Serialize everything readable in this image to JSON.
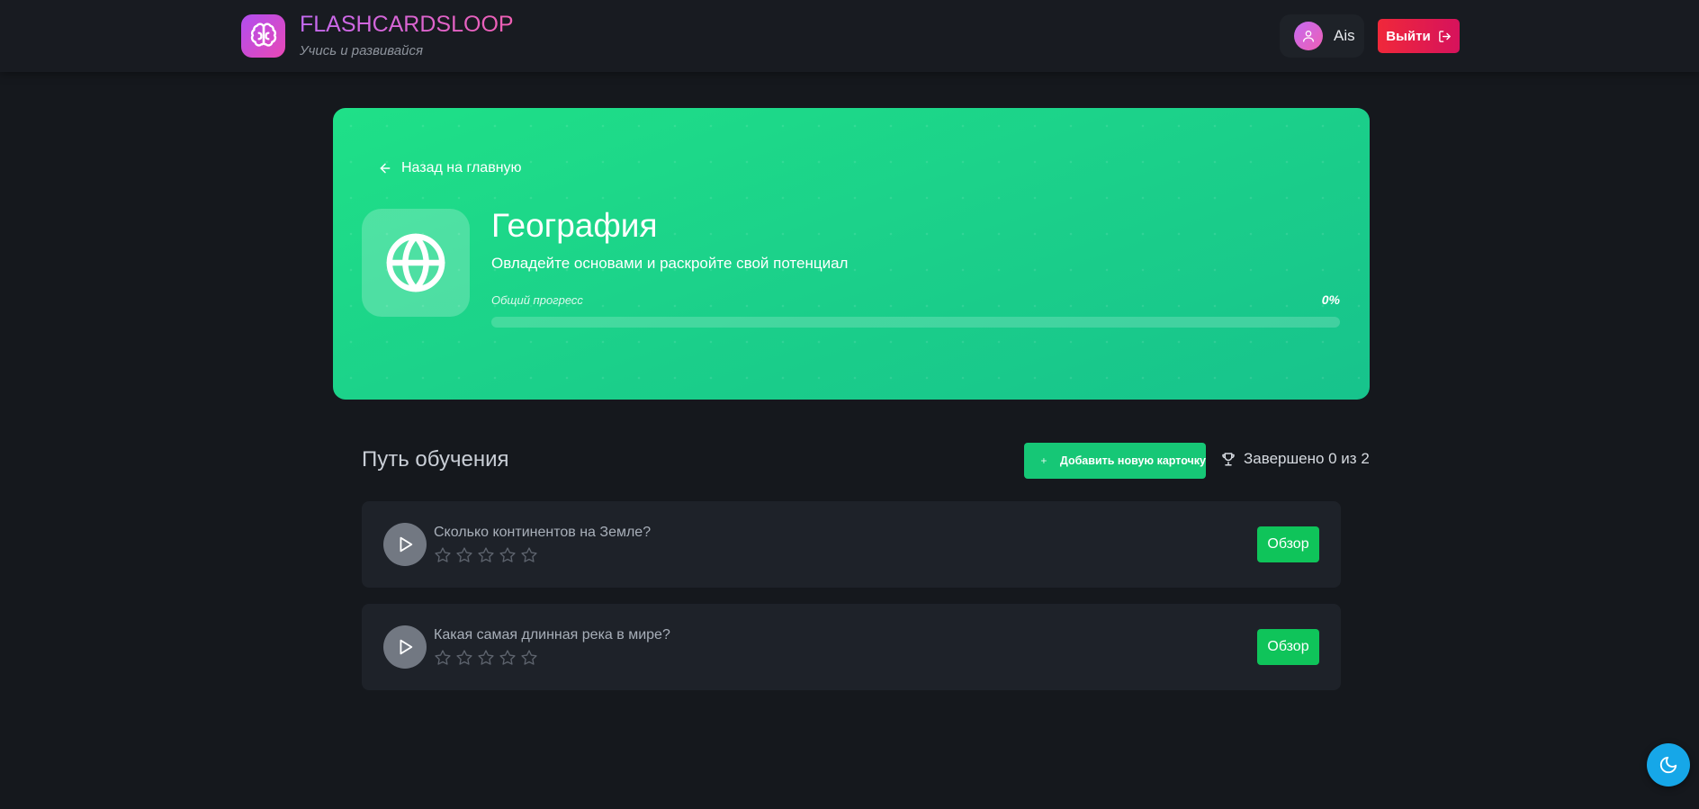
{
  "header": {
    "brand_title": "FLASHCARDSLOOP",
    "brand_subtitle": "Учись и развивайся",
    "logo_icon": "brain-icon",
    "user_name": "Ais",
    "user_icon": "user-icon",
    "logout_label": "Выйти",
    "logout_icon": "logout-icon"
  },
  "hero": {
    "back_label": "Назад на главную",
    "subject_icon": "globe-icon",
    "title": "География",
    "subtitle": "Овладейте основами и раскройте свой потенциал",
    "progress_label": "Общий прогресс",
    "progress_value": "0%",
    "progress_fraction": 0
  },
  "path": {
    "title": "Путь обучения",
    "add_card_label": "Добавить новую карточку",
    "completed_label": "Завершено 0 из 2",
    "completed_icon": "trophy-icon",
    "cards": [
      {
        "question": "Сколько континентов на Земле?",
        "rating": 0,
        "max_rating": 5,
        "review_label": "Обзор"
      },
      {
        "question": "Какая самая длинная река в мире?",
        "rating": 0,
        "max_rating": 5,
        "review_label": "Обзор"
      }
    ]
  },
  "theme_toggle_icon": "moon-icon",
  "colors": {
    "hero_green": "#1cd786",
    "add_button": "#16c776",
    "review_button": "#0fc45a",
    "logout_red": "#f0283a",
    "brand_purple": "#c46af2",
    "brand_pink": "#ef5fb3",
    "theme_toggle_blue": "#16a7e8"
  }
}
